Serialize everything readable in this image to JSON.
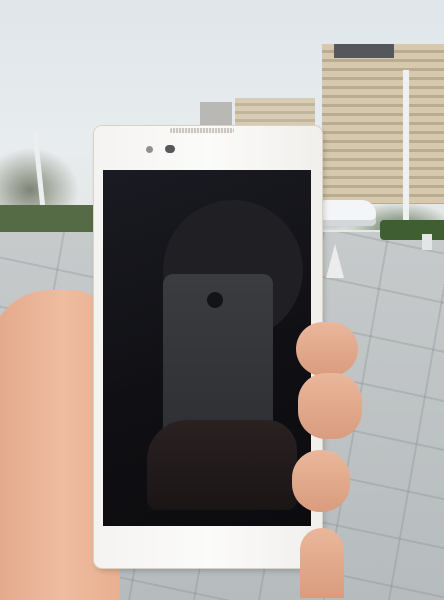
{
  "image": {
    "subject": "smartphone-held-in-hand",
    "setting": "outdoor-plaza",
    "colors": {
      "phone_body": "#f7f6f4",
      "phone_trim": "#d9c9a8",
      "screen": "#111114",
      "skin": "#e8b092",
      "sky": "#e3e9ec",
      "pavement": "#bec3c4"
    }
  }
}
